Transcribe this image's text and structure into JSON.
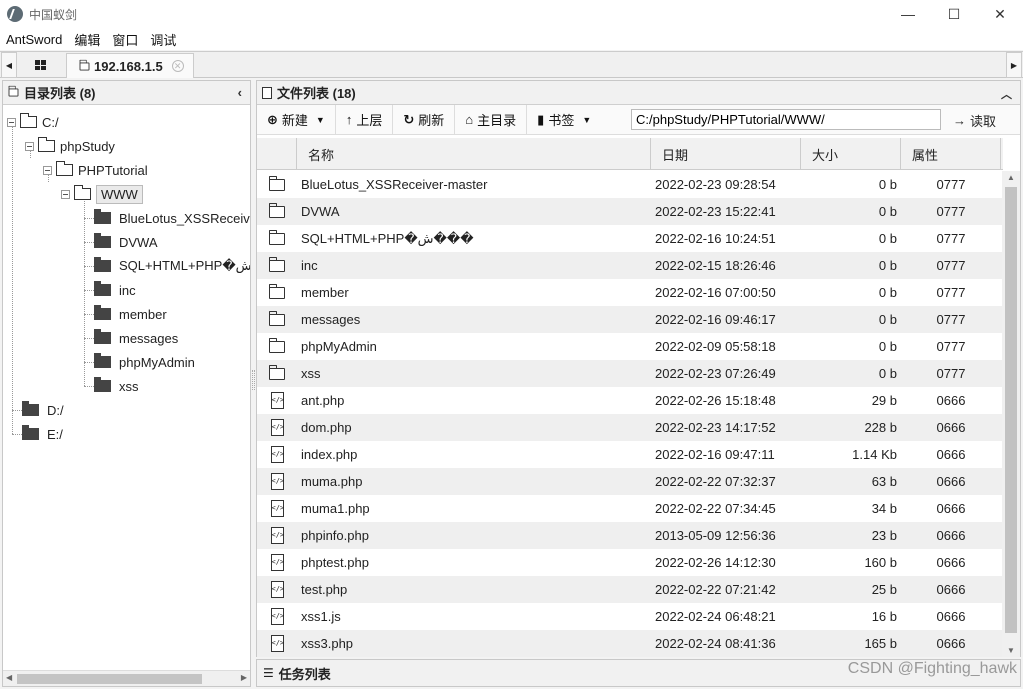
{
  "window": {
    "title": "中国蚁剑",
    "controls": [
      "—",
      "☐",
      "✕"
    ]
  },
  "menu": [
    "AntSword",
    "编辑",
    "窗口",
    "调试"
  ],
  "tabs": {
    "active": "192.168.1.5"
  },
  "left_panel": {
    "title": "目录列表 (8)",
    "tree": {
      "c": "C:/",
      "phpstudy": "phpStudy",
      "phptutorial": "PHPTutorial",
      "www": "WWW",
      "children": [
        "BlueLotus_XSSReceiver",
        "DVWA",
        "SQL+HTML+PHP�ش�",
        "inc",
        "member",
        "messages",
        "phpMyAdmin",
        "xss"
      ],
      "d": "D:/",
      "e": "E:/"
    }
  },
  "right_panel": {
    "title": "文件列表 (18)",
    "toolbar": {
      "new": "新建",
      "up": "上层",
      "refresh": "刷新",
      "home": "主目录",
      "bookmark": "书签",
      "path": "C:/phpStudy/PHPTutorial/WWW/",
      "read": "读取"
    },
    "columns": [
      "名称",
      "日期",
      "大小",
      "属性"
    ],
    "files": [
      {
        "type": "folder",
        "name": "BlueLotus_XSSReceiver-master",
        "date": "2022-02-23 09:28:54",
        "size": "0 b",
        "attr": "0777"
      },
      {
        "type": "folder",
        "name": "DVWA",
        "date": "2022-02-23 15:22:41",
        "size": "0 b",
        "attr": "0777"
      },
      {
        "type": "folder",
        "name": "SQL+HTML+PHP�ش���",
        "date": "2022-02-16 10:24:51",
        "size": "0 b",
        "attr": "0777"
      },
      {
        "type": "folder",
        "name": "inc",
        "date": "2022-02-15 18:26:46",
        "size": "0 b",
        "attr": "0777"
      },
      {
        "type": "folder",
        "name": "member",
        "date": "2022-02-16 07:00:50",
        "size": "0 b",
        "attr": "0777"
      },
      {
        "type": "folder",
        "name": "messages",
        "date": "2022-02-16 09:46:17",
        "size": "0 b",
        "attr": "0777"
      },
      {
        "type": "folder",
        "name": "phpMyAdmin",
        "date": "2022-02-09 05:58:18",
        "size": "0 b",
        "attr": "0777"
      },
      {
        "type": "folder",
        "name": "xss",
        "date": "2022-02-23 07:26:49",
        "size": "0 b",
        "attr": "0777"
      },
      {
        "type": "file",
        "name": "ant.php",
        "date": "2022-02-26 15:18:48",
        "size": "29 b",
        "attr": "0666"
      },
      {
        "type": "file",
        "name": "dom.php",
        "date": "2022-02-23 14:17:52",
        "size": "228 b",
        "attr": "0666"
      },
      {
        "type": "file",
        "name": "index.php",
        "date": "2022-02-16 09:47:11",
        "size": "1.14 Kb",
        "attr": "0666"
      },
      {
        "type": "file",
        "name": "muma.php",
        "date": "2022-02-22 07:32:37",
        "size": "63 b",
        "attr": "0666"
      },
      {
        "type": "file",
        "name": "muma1.php",
        "date": "2022-02-22 07:34:45",
        "size": "34 b",
        "attr": "0666"
      },
      {
        "type": "file",
        "name": "phpinfo.php",
        "date": "2013-05-09 12:56:36",
        "size": "23 b",
        "attr": "0666"
      },
      {
        "type": "file",
        "name": "phptest.php",
        "date": "2022-02-26 14:12:30",
        "size": "160 b",
        "attr": "0666"
      },
      {
        "type": "file",
        "name": "test.php",
        "date": "2022-02-22 07:21:42",
        "size": "25 b",
        "attr": "0666"
      },
      {
        "type": "file",
        "name": "xss1.js",
        "date": "2022-02-24 06:48:21",
        "size": "16 b",
        "attr": "0666"
      },
      {
        "type": "file",
        "name": "xss3.php",
        "date": "2022-02-24 08:41:36",
        "size": "165 b",
        "attr": "0666"
      }
    ]
  },
  "task_panel": {
    "title": "任务列表"
  },
  "watermark": "CSDN @Fighting_hawk"
}
